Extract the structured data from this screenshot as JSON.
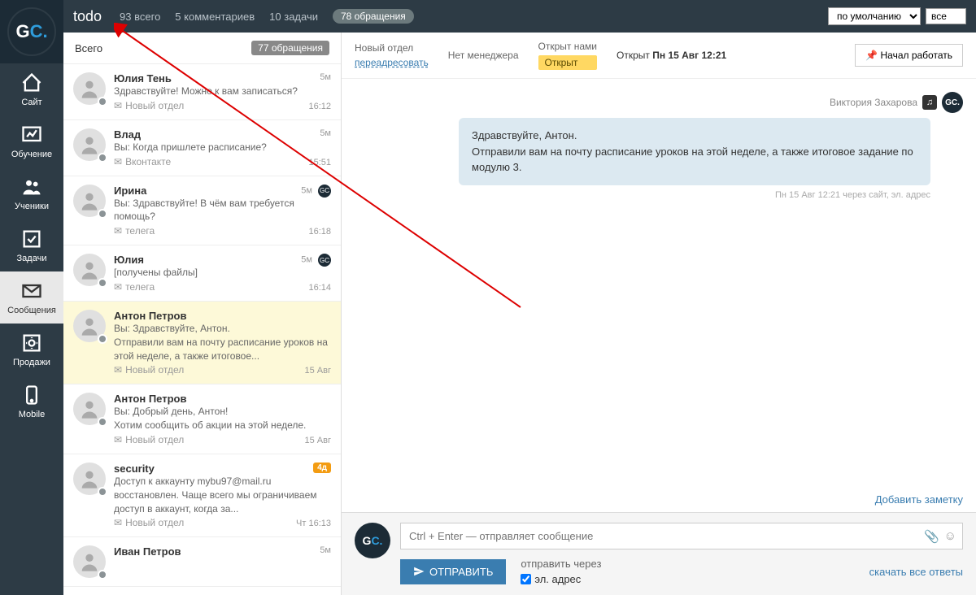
{
  "topbar": {
    "todo": "todo",
    "total": "93 всего",
    "comments": "5 комментариев",
    "tasks": "10 задачи",
    "refs": "78 обращения",
    "sort": "по умолчанию",
    "filter": "все"
  },
  "sidebar": {
    "items": [
      {
        "label": "Сайт"
      },
      {
        "label": "Обучение"
      },
      {
        "label": "Ученики"
      },
      {
        "label": "Задачи"
      },
      {
        "label": "Сообщения"
      },
      {
        "label": "Продажи"
      },
      {
        "label": "Mobile"
      }
    ]
  },
  "list": {
    "header": "Всего",
    "count": "77 обращения",
    "items": [
      {
        "name": "Юлия Тень",
        "line": "Здравствуйте! Можно к вам записаться?",
        "src": "Новый отдел",
        "age": "5м",
        "time": "16:12",
        "logo": false
      },
      {
        "name": "Влад",
        "line": "Вы: Когда пришлете расписание?",
        "src": "Вконтакте",
        "age": "5м",
        "time": "15:51",
        "logo": false
      },
      {
        "name": "Ирина",
        "line": "Вы: Здравствуйте! В чём вам требуется помощь?",
        "src": "телега",
        "age": "5м",
        "time": "16:18",
        "logo": true
      },
      {
        "name": "Юлия",
        "line": "[получены файлы]",
        "src": "телега",
        "age": "5м",
        "time": "16:14",
        "logo": true
      },
      {
        "name": "Антон Петров",
        "line": "Вы: Здравствуйте, Антон.\nОтправили вам на почту расписание уроков на этой неделе, а также итоговое...",
        "src": "Новый отдел",
        "age": "",
        "time": "15 Авг",
        "logo": false,
        "selected": true
      },
      {
        "name": "Антон Петров",
        "line": "Вы: Добрый день, Антон!\nХотим сообщить об акции на этой неделе.",
        "src": "Новый отдел",
        "age": "",
        "time": "15 Авг",
        "logo": false
      },
      {
        "name": "security",
        "line": "Доступ к аккаунту mybu97@mail.ru восстановлен. Чаще всего мы ограничиваем доступ в аккаунт, когда за...",
        "src": "Новый отдел",
        "age": "4д",
        "time": "Чт 16:13",
        "logo": false,
        "orange": true
      },
      {
        "name": "Иван Петров",
        "line": "",
        "src": "",
        "age": "5м",
        "time": "",
        "logo": false
      }
    ]
  },
  "chat": {
    "dept_label": "Новый отдел",
    "forward": "переадресовать",
    "no_manager": "Нет менеджера",
    "opened_by": "Открыт нами",
    "open_tag": "Открыт",
    "open_label": "Открыт",
    "open_time": "Пн 15 Авг 12:21",
    "btn_work": "Начал работать",
    "author": "Виктория Захарова",
    "bubble": "Здравствуйте, Антон.\nОтправили вам на почту расписание уроков на этой неделе, а также итоговое задание по модулю 3.",
    "msg_time": "Пн 15 Авг 12:21 через сайт, эл. адрес",
    "note": "Добавить заметку"
  },
  "composer": {
    "placeholder": "Ctrl + Enter — отправляет сообщение",
    "send": "ОТПРАВИТЬ",
    "via": "отправить через",
    "email": "эл. адрес",
    "download": "скачать все ответы"
  }
}
